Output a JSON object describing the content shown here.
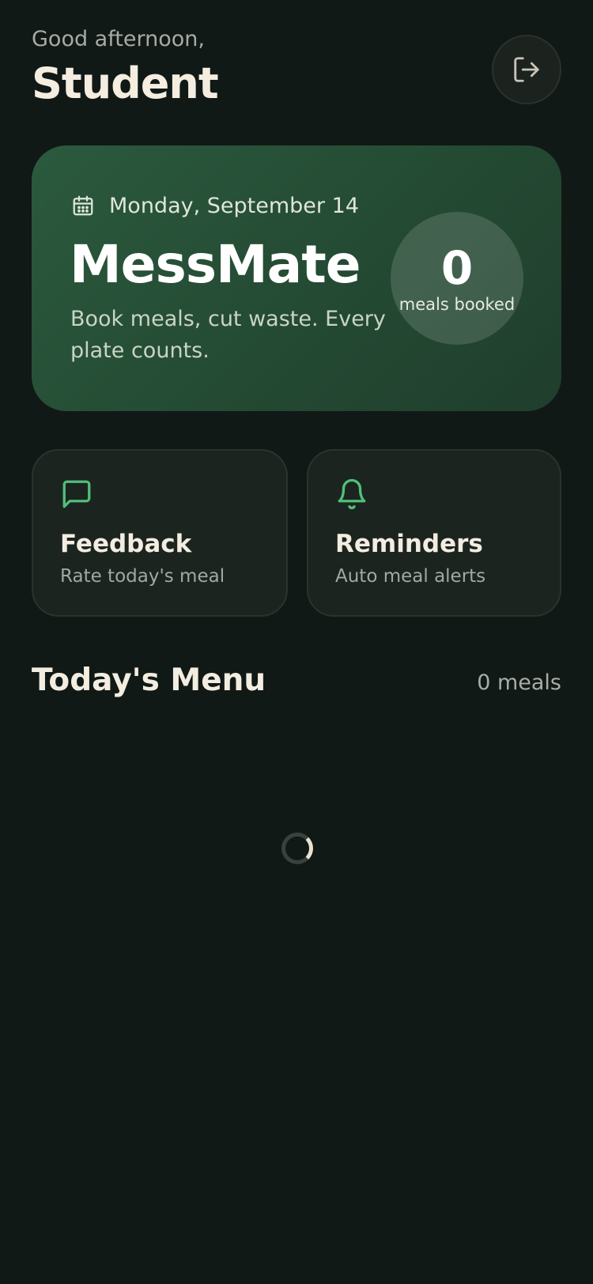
{
  "header": {
    "greeting": "Good afternoon,",
    "user_name": "Student",
    "logout_icon": "logout-icon"
  },
  "hero": {
    "date_icon": "calendar-icon",
    "date": "Monday, September 14",
    "app_title": "MessMate",
    "tagline": "Book meals, cut waste. Every plate counts.",
    "meals_booked_count": "0",
    "meals_booked_label": "meals booked"
  },
  "actions": [
    {
      "icon": "message-square-icon",
      "title": "Feedback",
      "subtitle": "Rate today's meal"
    },
    {
      "icon": "bell-icon",
      "title": "Reminders",
      "subtitle": "Auto meal alerts"
    }
  ],
  "menu": {
    "title": "Today's Menu",
    "count": "0 meals",
    "loading": true
  },
  "colors": {
    "background": "#111916",
    "hero_green": "#2b5a3e",
    "accent_green": "#4fbf7a",
    "text_primary": "#f3ede1",
    "text_secondary": "#a7aba5"
  }
}
